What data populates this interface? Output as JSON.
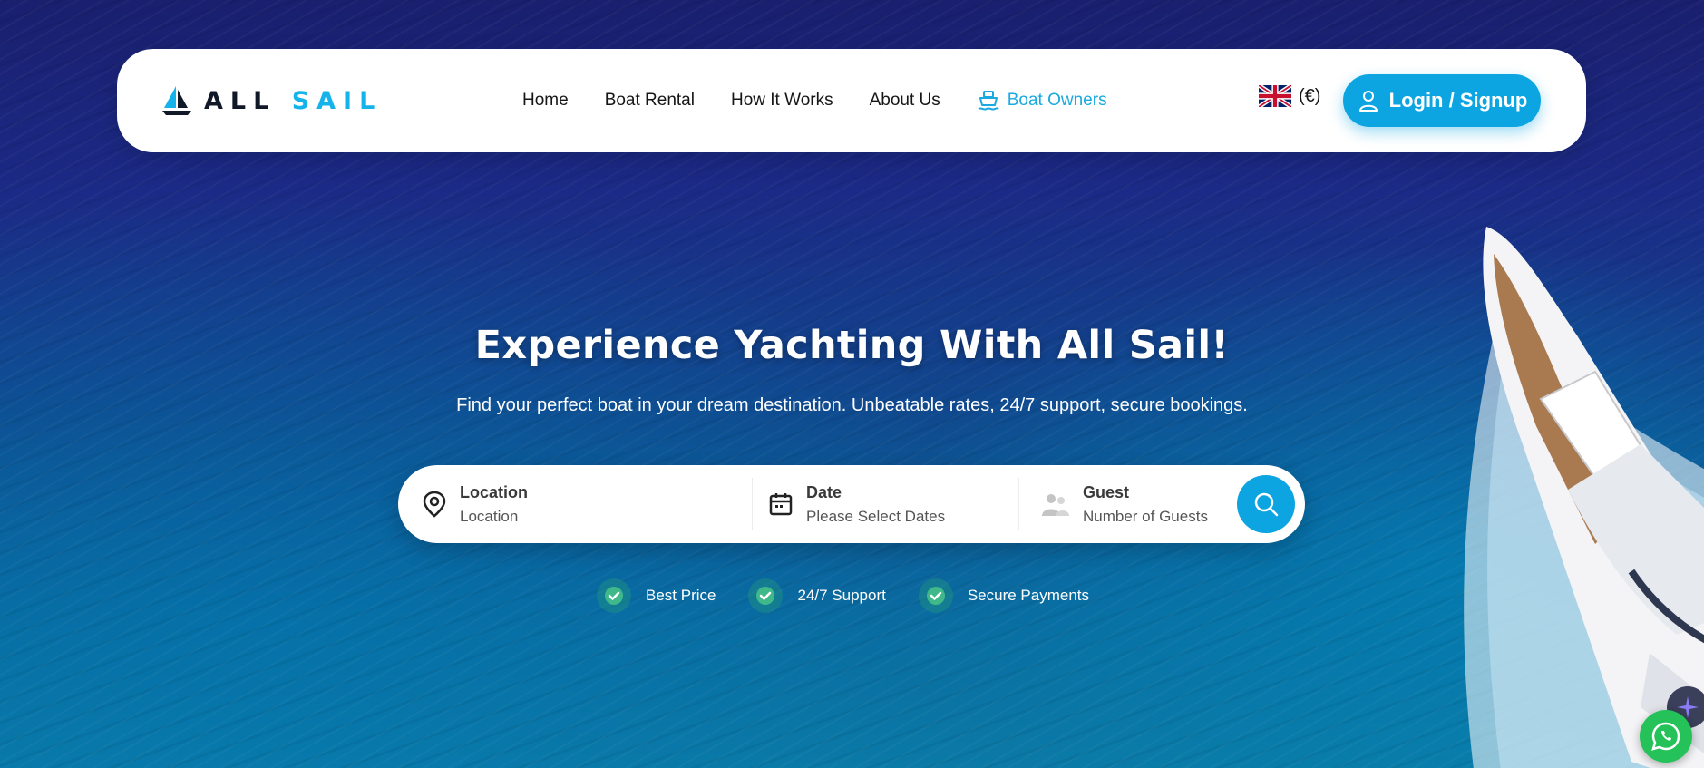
{
  "brand": {
    "part1": "ALL",
    "part2": "SAIL",
    "accent_color": "#16b3ea",
    "dark_color": "#111827"
  },
  "nav": {
    "items": [
      {
        "label": "Home"
      },
      {
        "label": "Boat Rental"
      },
      {
        "label": "How It Works"
      },
      {
        "label": "About Us"
      }
    ],
    "owners_label": "Boat Owners",
    "owners_icon": "ship-icon"
  },
  "lang": {
    "flag": "uk-flag-icon",
    "currency": "(€)"
  },
  "auth": {
    "login_label": "Login / Signup",
    "icon": "user-icon"
  },
  "hero": {
    "title": "Experience Yachting With All Sail!",
    "subtitle": "Find your perfect boat in your dream destination. Unbeatable rates, 24/7 support, secure bookings."
  },
  "search": {
    "location": {
      "label": "Location",
      "value": "Location",
      "icon": "map-pin-icon"
    },
    "date": {
      "label": "Date",
      "value": "Please Select Dates",
      "icon": "calendar-icon"
    },
    "guest": {
      "label": "Guest",
      "value": "Number of Guests",
      "icon": "users-icon"
    },
    "button_icon": "search-icon",
    "button_color": "#0ca5e2"
  },
  "features": [
    {
      "label": "Best Price"
    },
    {
      "label": "24/7 Support"
    },
    {
      "label": "Secure Payments"
    }
  ],
  "floating": {
    "ai_icon": "sparkle-icon",
    "chat_icon": "whatsapp-icon",
    "chat_color": "#25c25a"
  }
}
